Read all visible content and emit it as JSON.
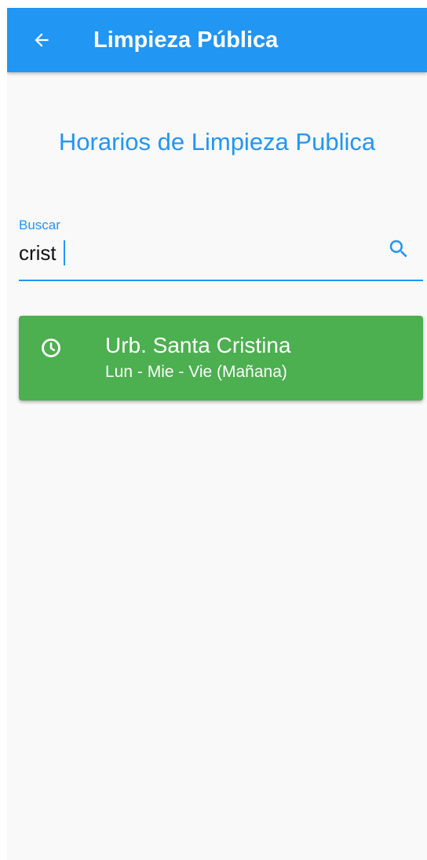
{
  "app_bar": {
    "title": "Limpieza Pública",
    "back_icon": "arrow-left-icon",
    "background_color": "#2196f3"
  },
  "page": {
    "heading": "Horarios de Limpieza Publica",
    "heading_color": "#2196f3",
    "background_color": "#f9f9f9"
  },
  "search": {
    "label": "Buscar",
    "value": "crist",
    "icon": "search-icon",
    "accent_color": "#2196f3"
  },
  "results": [
    {
      "icon": "clock-icon",
      "title": "Urb. Santa Cristina",
      "subtitle": "Lun - Mie - Vie (Mañana)",
      "background_color": "#4caf50"
    }
  ]
}
